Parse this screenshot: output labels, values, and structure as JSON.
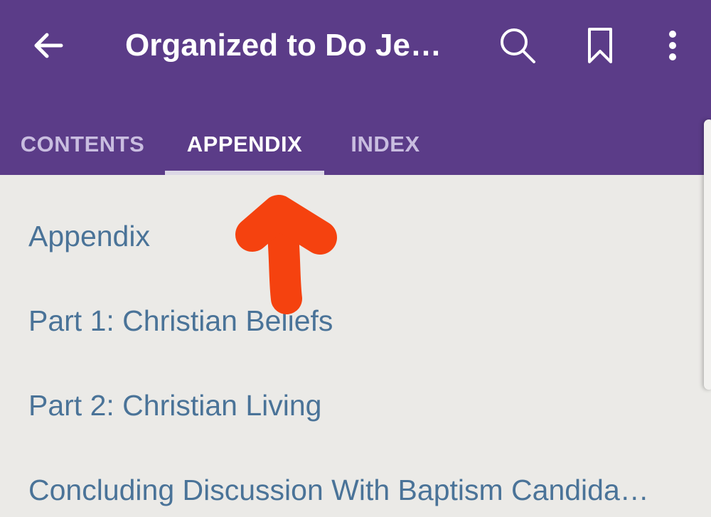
{
  "app_bar": {
    "title": "Organized to Do Je…",
    "background": "#5b3c88",
    "icons": {
      "back": "arrow-left-icon",
      "search": "search-icon",
      "bookmark": "bookmark-icon",
      "more": "more-vertical-icon"
    }
  },
  "tabs": [
    {
      "label": "CONTENTS",
      "selected": false
    },
    {
      "label": "APPENDIX",
      "selected": true
    },
    {
      "label": "INDEX",
      "selected": false
    }
  ],
  "list": {
    "items": [
      {
        "label": "Appendix"
      },
      {
        "label": "Part 1: Christian Beliefs"
      },
      {
        "label": "Part 2: Christian Living"
      },
      {
        "label": "Concluding Discussion With Baptism Candida…"
      }
    ],
    "text_color": "#4a7398"
  },
  "annotation": {
    "shape": "up-arrow",
    "color": "#f5420f"
  }
}
